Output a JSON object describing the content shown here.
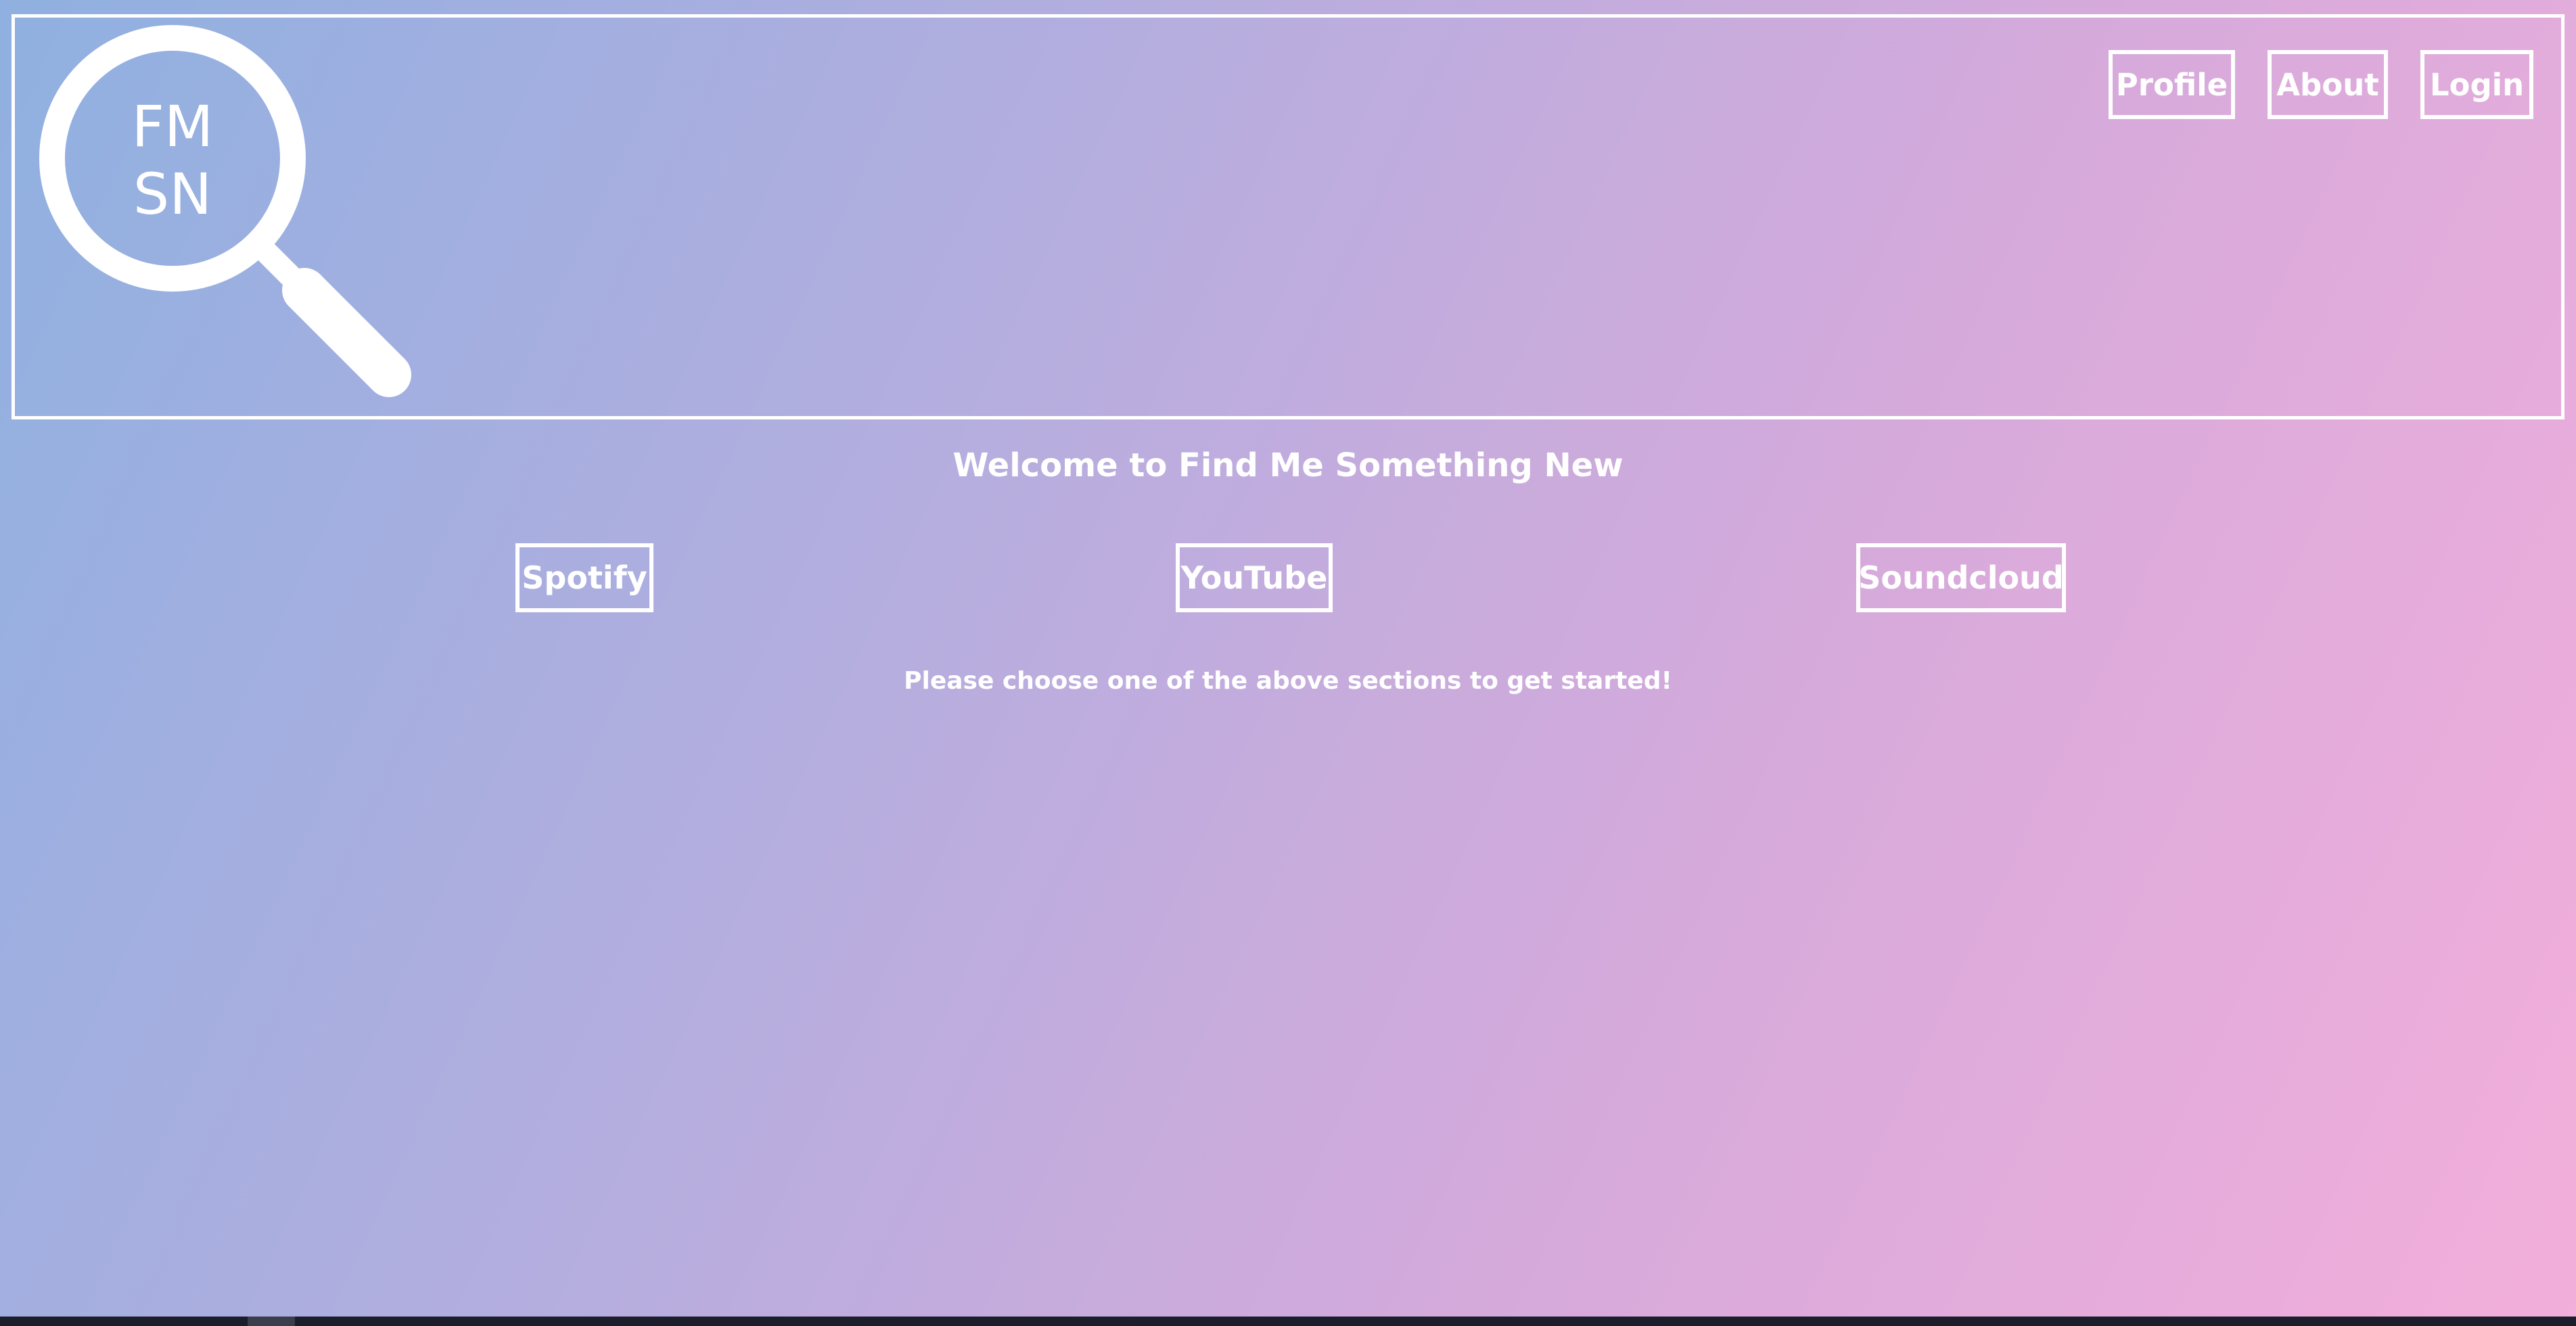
{
  "header": {
    "logo": {
      "icon": "magnifying-glass-icon",
      "line1": "FM",
      "line2": "SN"
    },
    "nav": [
      {
        "label": "Profile"
      },
      {
        "label": "About"
      },
      {
        "label": "Login"
      }
    ]
  },
  "main": {
    "title": "Welcome to Find Me Something New",
    "sections": [
      {
        "label": "Spotify"
      },
      {
        "label": "YouTube"
      },
      {
        "label": "Soundcloud"
      }
    ],
    "prompt": "Please choose one of the above sections to get started!"
  },
  "colors": {
    "foreground": "#ffffff",
    "gradient_start": "#8fb0e0",
    "gradient_end": "#f3aedb"
  }
}
